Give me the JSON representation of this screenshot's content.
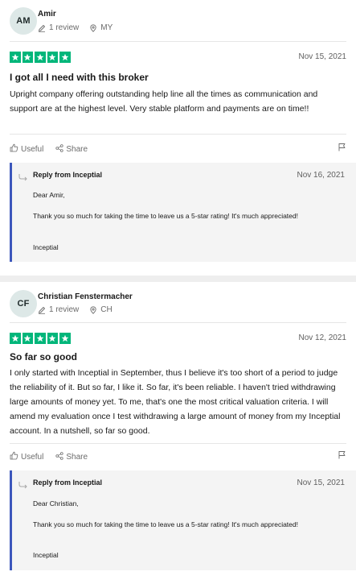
{
  "colors": {
    "star_green": "#00b67a",
    "reply_border": "#3c57bc",
    "reply_bg": "#f4f4f4",
    "avatar_bg": "#dde8e7"
  },
  "icons": {
    "review_count": "pencil-icon",
    "location": "location-pin-icon",
    "useful": "thumbs-up-icon",
    "share": "share-icon",
    "flag": "flag-icon",
    "reply": "reply-arrow-icon",
    "star": "star-icon"
  },
  "reviews": [
    {
      "initials": "AM",
      "name": "Amir",
      "review_count": "1 review",
      "country": "MY",
      "rating": 5,
      "date": "Nov 15, 2021",
      "title": "I got all I need with this broker",
      "body": "Upright company offering outstanding help line all the times as communication and support are at the highest level. Very stable platform and payments are on time!!",
      "useful_label": "Useful",
      "share_label": "Share",
      "reply": {
        "from": "Reply from Inceptial",
        "date": "Nov 16, 2021",
        "greeting": "Dear Amir,",
        "message": "Thank you so much for taking the time to leave us a 5-star rating! It's much appreciated!",
        "signature": "Inceptial"
      }
    },
    {
      "initials": "CF",
      "name": "Christian Fenstermacher",
      "review_count": "1 review",
      "country": "CH",
      "rating": 5,
      "date": "Nov 12, 2021",
      "title": "So far so good",
      "body": "I only started with Inceptial in September, thus I believe it's too short of a period to judge the reliability of it. But so far, I like it. So far, it's been reliable. I haven't tried withdrawing large amounts of money yet. To me, that's one the most critical valuation criteria. I will amend my evaluation once I test withdrawing a large amount of money from my Inceptial account. In a nutshell, so far so good.",
      "useful_label": "Useful",
      "share_label": "Share",
      "reply": {
        "from": "Reply from Inceptial",
        "date": "Nov 15, 2021",
        "greeting": "Dear Christian,",
        "message": "Thank you so much for taking the time to leave us a 5-star rating! It's much appreciated!",
        "signature": "Inceptial"
      }
    }
  ]
}
